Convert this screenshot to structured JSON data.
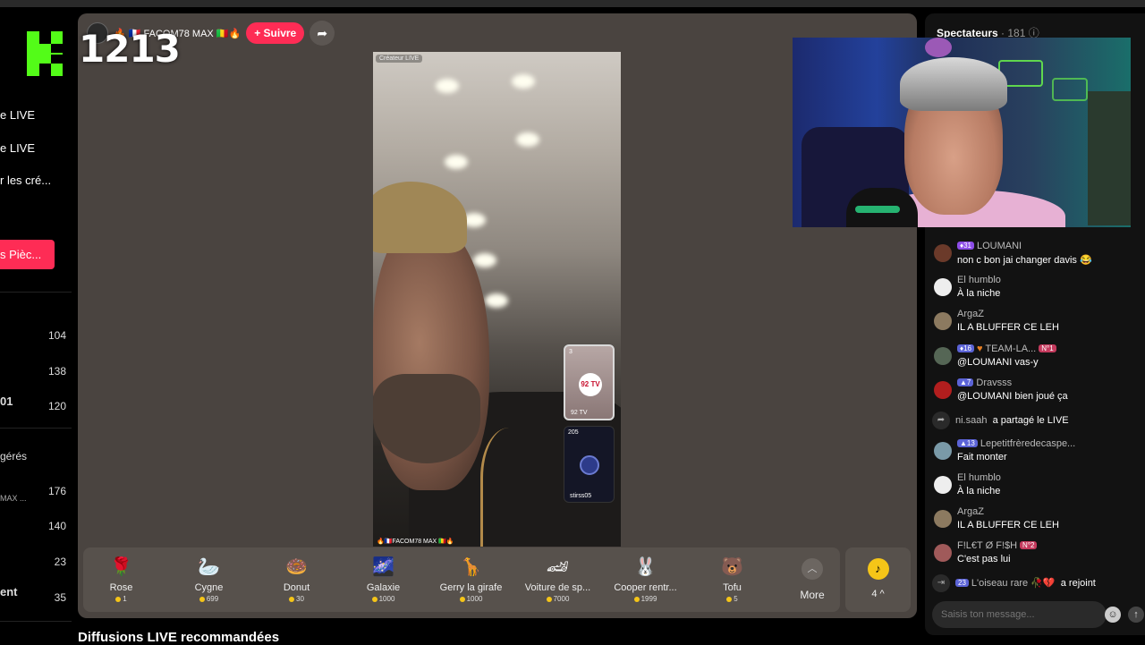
{
  "viewer_count": "1213",
  "sidebar": {
    "items": [
      {
        "label": "e LIVE"
      },
      {
        "label": "e LIVE"
      },
      {
        "label": "r les cré..."
      }
    ],
    "coins_button": "s Pièc...",
    "accounts": [
      {
        "name": "",
        "count": "104"
      },
      {
        "name": "",
        "count": "138"
      },
      {
        "name": "01",
        "count": "120"
      }
    ],
    "section_label": "gérés",
    "managed": [
      {
        "name": "MAX ...",
        "count": "176"
      },
      {
        "name": "",
        "count": "140"
      },
      {
        "name": "",
        "count": "23"
      },
      {
        "name": "ent",
        "count": "35"
      }
    ]
  },
  "player": {
    "host_name": "🔥 🇫🇷 FACOM78 MAX 🇲🇱🔥",
    "follow_label": "+ Suivre",
    "video_tag": "Créateur LIVE",
    "video_bottom_label": "🔥🇫🇷FACOM78 MAX 🇲🇱🔥",
    "pips": [
      {
        "badge": "3",
        "logo": "92 TV",
        "label": "92 TV"
      },
      {
        "badge": "205",
        "label": "stirss05"
      }
    ]
  },
  "gifts": [
    {
      "name": "Rose",
      "price": "1",
      "icon": "rose-icon",
      "glyph": "🌹"
    },
    {
      "name": "Cygne",
      "price": "699",
      "icon": "swan-icon",
      "glyph": "🦢"
    },
    {
      "name": "Donut",
      "price": "30",
      "icon": "donut-icon",
      "glyph": "🍩"
    },
    {
      "name": "Galaxie",
      "price": "1000",
      "icon": "galaxy-icon",
      "glyph": "🌌"
    },
    {
      "name": "Gerry la girafe",
      "price": "1000",
      "icon": "giraffe-icon",
      "glyph": "🦒"
    },
    {
      "name": "Voiture de sp...",
      "price": "7000",
      "icon": "sports-car-icon",
      "glyph": "🏎"
    },
    {
      "name": "Cooper rentr...",
      "price": "1999",
      "icon": "cooper-icon",
      "glyph": "🐰"
    },
    {
      "name": "Tofu",
      "price": "5",
      "icon": "tofu-icon",
      "glyph": "🐻"
    }
  ],
  "more_label": "More",
  "coin_count": "4 ^",
  "recommended_title": "Diffusions LIVE recommandées",
  "chat": {
    "spectateurs_label": "Spectateurs",
    "spectateurs_count": "· 181",
    "input_placeholder": "Saisis ton message...",
    "messages": [
      {
        "user": "LOUMANI",
        "level": "31",
        "text": "non c bon jai changer davis 😂"
      },
      {
        "user": "El humblo",
        "level": "",
        "text": "À la niche"
      },
      {
        "user": "ArgaZ",
        "level": "",
        "text": "IL A BLUFFER CE LEH"
      },
      {
        "user": "TEAM-LA...",
        "level": "16",
        "rank": "N°1",
        "text": "@LOUMANI vas-y"
      },
      {
        "user": "Dravsss",
        "level": "7",
        "text": "@LOUMANI bien joué ça"
      },
      {
        "user": "Lepetitfrèredecaspe...",
        "level": "13",
        "text": "Fait monter"
      },
      {
        "user": "El humblo",
        "level": "",
        "text": "À la niche"
      },
      {
        "user": "ArgaZ",
        "level": "",
        "text": "IL A BLUFFER CE LEH"
      },
      {
        "user": "F!L€T Ø F!$H",
        "level": "",
        "rank": "N°2",
        "text": "C'est pas lui"
      }
    ],
    "share_user": "ni.saah",
    "share_text": "a partagé le LIVE",
    "join_level": "23",
    "join_user": "L'oiseau rare 🥀💔",
    "join_text": "a rejoint"
  }
}
